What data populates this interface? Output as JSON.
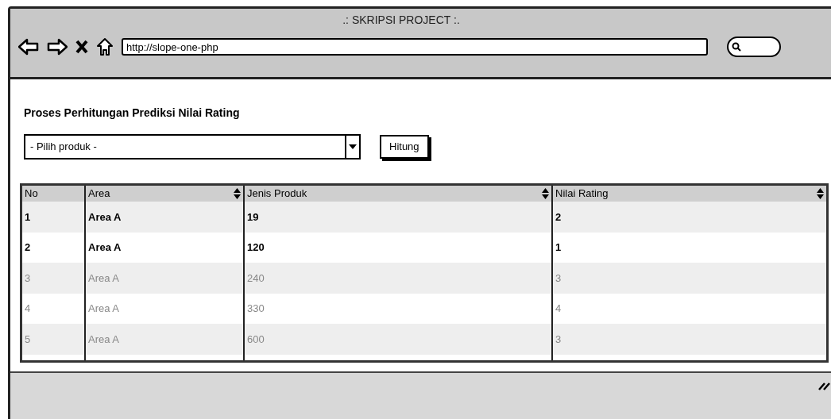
{
  "window": {
    "title": ".: SKRIPSI PROJECT :."
  },
  "address_bar": {
    "value": "http://slope-one-php"
  },
  "heading": "Proses Perhitungan Prediksi Nilai Rating",
  "product_select": {
    "value": "- Pilih produk -"
  },
  "button": "Hitung",
  "table": {
    "columns": [
      {
        "label": "No",
        "sortable": false
      },
      {
        "label": "Area",
        "sortable": true
      },
      {
        "label": "Jenis Produk",
        "sortable": true
      },
      {
        "label": "Nilai Rating",
        "sortable": true
      }
    ],
    "rows": [
      {
        "cells": [
          "1",
          "Area A",
          "19",
          "2"
        ],
        "disabled": false
      },
      {
        "cells": [
          "2",
          "Area A",
          "120",
          "1"
        ],
        "disabled": false
      },
      {
        "cells": [
          "3",
          "Area A",
          "240",
          "3"
        ],
        "disabled": true
      },
      {
        "cells": [
          "4",
          "Area A",
          "330",
          "4"
        ],
        "disabled": true
      },
      {
        "cells": [
          "5",
          "Area A",
          "600",
          "3"
        ],
        "disabled": true
      }
    ]
  }
}
